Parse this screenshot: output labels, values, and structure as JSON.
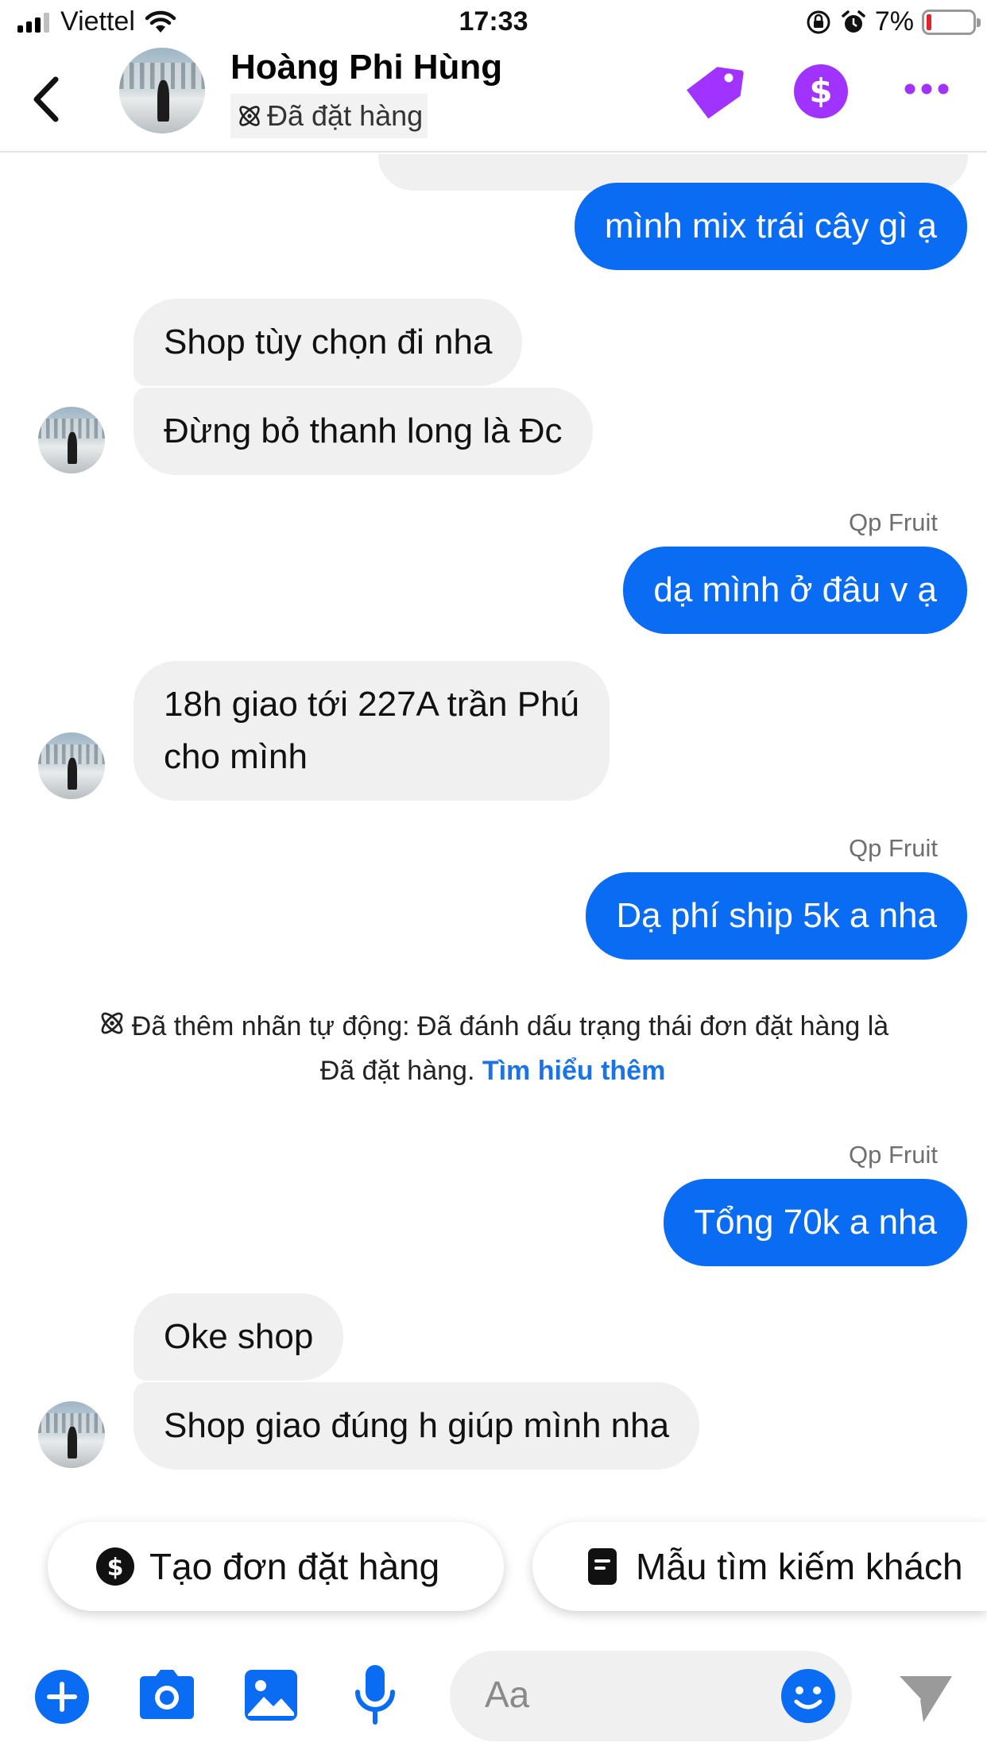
{
  "status_bar": {
    "carrier": "Viettel",
    "time": "17:33",
    "battery": "7%",
    "battery_level": 0.07
  },
  "header": {
    "contact_name": "Hoàng Phi Hùng",
    "contact_status": "Đã đặt hàng",
    "accent_color": "#a033ff"
  },
  "messages": [
    {
      "side": "out",
      "text": "mình mix trái cây gì ạ"
    },
    {
      "side": "in",
      "text": "Shop tùy chọn đi nha"
    },
    {
      "side": "in",
      "text": "Đừng bỏ thanh long là Đc"
    },
    {
      "side": "out",
      "sender": "Qp Fruit",
      "text": "dạ mình ở đâu v ạ"
    },
    {
      "side": "in",
      "lines": [
        "18h giao tới 227A trần Phú",
        "cho mình"
      ]
    },
    {
      "side": "out",
      "sender": "Qp Fruit",
      "text": "Dạ phí ship 5k a nha"
    },
    {
      "side": "out",
      "sender": "Qp Fruit",
      "text": "Tổng 70k a nha"
    },
    {
      "side": "in",
      "text": "Oke shop"
    },
    {
      "side": "in",
      "text": "Shop giao đúng h giúp mình nha"
    }
  ],
  "system_note": {
    "line1": "Đã thêm nhãn tự động: Đã đánh dấu trạng thái đơn đặt hàng là",
    "line2": "Đã đặt hàng.",
    "link": "Tìm hiểu thêm"
  },
  "quick_replies": [
    {
      "label": "Tạo đơn đặt hàng",
      "icon": "dollar-icon"
    },
    {
      "label": "Mẫu tìm kiếm khách",
      "icon": "note-icon"
    }
  ],
  "composer": {
    "placeholder": "Aa",
    "outgoing_color": "#0a6cf2",
    "icon_color": "#0a6cf2"
  }
}
